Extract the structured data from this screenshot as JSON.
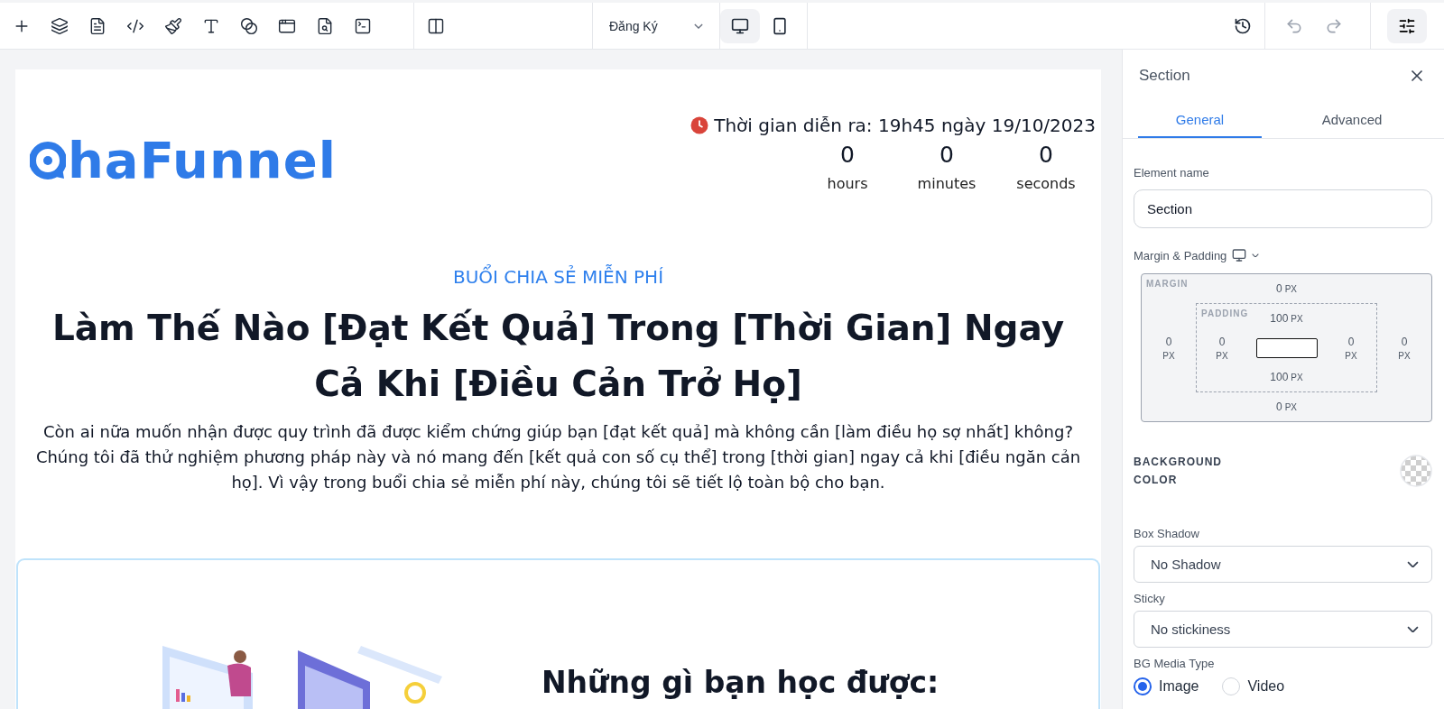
{
  "toolbar": {
    "page_select": {
      "value": "Đăng Ký"
    },
    "devices": [
      {
        "kind": "desktop",
        "selected": true
      },
      {
        "kind": "mobile",
        "selected": false
      }
    ]
  },
  "page": {
    "logo": {
      "text": "haFunnel"
    },
    "event_time": "Thời gian diễn ra: 19h45 ngày 19/10/2023",
    "countdown": [
      {
        "value": "0",
        "unit": "hours"
      },
      {
        "value": "0",
        "unit": "minutes"
      },
      {
        "value": "0",
        "unit": "seconds"
      }
    ],
    "eyebrow": "BUỔI CHIA SẺ MIỄN PHÍ",
    "heading": "Làm Thế Nào [Đạt Kết Quả] Trong [Thời Gian] Ngay Cả Khi [Điều Cản Trở Họ]",
    "intro": "Còn ai nữa muốn nhận được quy trình đã được kiểm chứng giúp bạn [đạt kết quả] mà không cần [làm điều họ sợ nhất] không? Chúng tôi đã thử nghiệm phương pháp này và nó mang đến [kết quả con số cụ thể] trong [thời gian] ngay cả khi [điều ngăn cản họ]. Vì vậy trong buổi chia sẻ miễn phí này, chúng tôi sẽ tiết lộ toàn bộ cho bạn.",
    "section_heading": "Những gì bạn học được:"
  },
  "panel": {
    "title": "Section",
    "tabs": [
      {
        "label": "General",
        "selected": true
      },
      {
        "label": "Advanced",
        "selected": false
      }
    ],
    "element_name": {
      "label": "Element name",
      "value": "Section"
    },
    "spacing": {
      "label": "Margin & Padding",
      "margin": {
        "label": "MARGIN",
        "top": {
          "value": "0",
          "unit": "PX"
        },
        "left": {
          "value": "0",
          "unit": "PX"
        },
        "right": {
          "value": "0",
          "unit": "PX"
        },
        "bottom": {
          "value": "0",
          "unit": "PX"
        }
      },
      "padding": {
        "label": "PADDING",
        "top": {
          "value": "100",
          "unit": "PX"
        },
        "left": {
          "value": "0",
          "unit": "PX"
        },
        "right": {
          "value": "0",
          "unit": "PX"
        },
        "bottom": {
          "value": "100",
          "unit": "PX"
        }
      }
    },
    "background_color": {
      "label": "BACKGROUND COLOR"
    },
    "box_shadow": {
      "label": "Box Shadow",
      "value": "No Shadow"
    },
    "sticky": {
      "label": "Sticky",
      "value": "No stickiness"
    },
    "bg_media_type": {
      "label": "BG Media Type",
      "options": [
        {
          "label": "Image",
          "selected": true
        },
        {
          "label": "Video",
          "selected": false
        }
      ]
    }
  }
}
